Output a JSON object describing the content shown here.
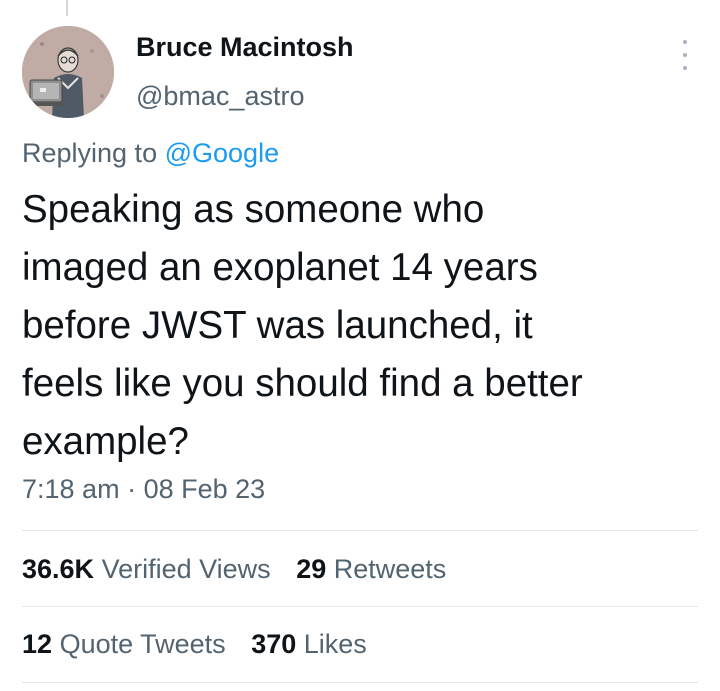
{
  "tweet": {
    "author_name": "Bruce Macintosh",
    "author_handle": "@bmac_astro",
    "replying_prefix": "Replying to",
    "replying_to": "@Google",
    "text_lines": [
      "Speaking as someone who",
      "imaged an exoplanet 14 years",
      "before JWST was launched, it",
      "feels like you should find a better",
      "example?"
    ],
    "time": "7:18 am",
    "separator": "·",
    "date": "08 Feb 23"
  },
  "stats": {
    "views": {
      "count": "36.6K",
      "label": "Verified Views"
    },
    "retweets": {
      "count": "29",
      "label": "Retweets"
    },
    "quote_tweets": {
      "count": "12",
      "label": "Quote Tweets"
    },
    "likes": {
      "count": "370",
      "label": "Likes"
    }
  },
  "icons": {
    "more": "more-vertical-icon",
    "avatar": "avatar-illustration"
  },
  "colors": {
    "text": "#0f1419",
    "secondary": "#536471",
    "link": "#1d9bf0",
    "divider": "#e1e8ed"
  }
}
